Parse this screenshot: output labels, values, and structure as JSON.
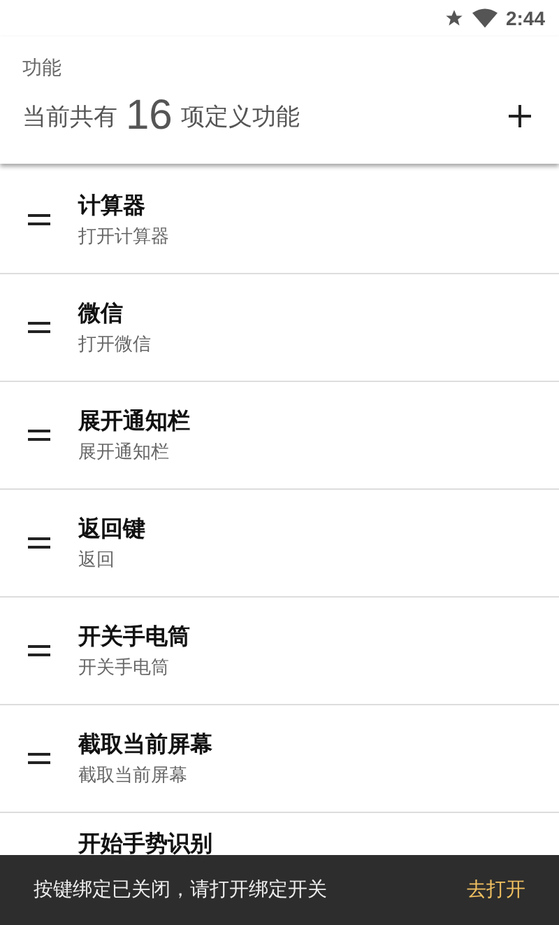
{
  "status_bar": {
    "time": "2:44"
  },
  "header": {
    "title": "功能",
    "count_prefix": "当前共有",
    "count": "16",
    "count_suffix": "项定义功能"
  },
  "items": [
    {
      "title": "计算器",
      "subtitle": "打开计算器"
    },
    {
      "title": "微信",
      "subtitle": "打开微信"
    },
    {
      "title": "展开通知栏",
      "subtitle": "展开通知栏"
    },
    {
      "title": "返回键",
      "subtitle": "返回"
    },
    {
      "title": "开关手电筒",
      "subtitle": "开关手电筒"
    },
    {
      "title": "截取当前屏幕",
      "subtitle": "截取当前屏幕"
    },
    {
      "title": "开始手势识别"
    }
  ],
  "snackbar": {
    "message": "按键绑定已关闭，请打开绑定开关",
    "action": "去打开"
  }
}
